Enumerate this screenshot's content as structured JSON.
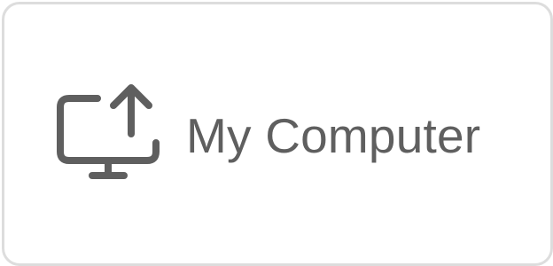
{
  "tile": {
    "label": "My Computer",
    "icon": "computer-upload-icon"
  },
  "colors": {
    "text": "#5f5f5f",
    "icon": "#5f5f5f",
    "border": "#dddddd",
    "background": "#ffffff"
  }
}
